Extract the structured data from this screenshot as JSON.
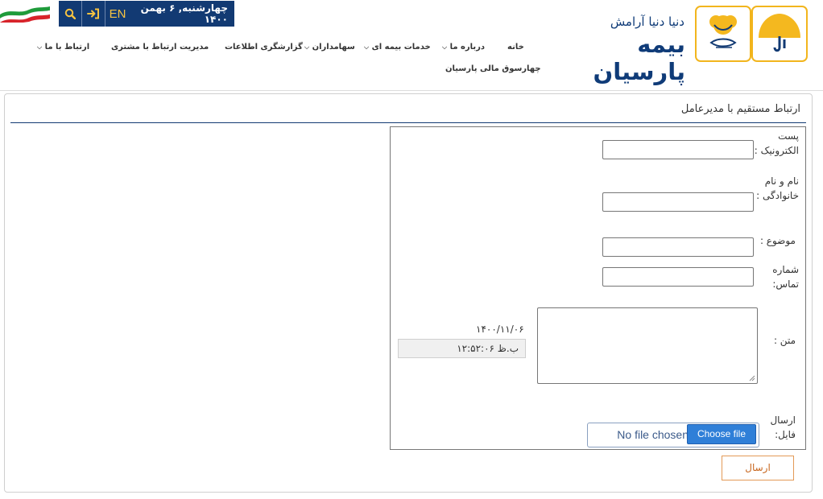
{
  "header": {
    "date_text": "چهارشنبه, ۶ بهمن ۱۴۰۰",
    "lang_label": "EN",
    "search_icon": "search-icon",
    "login_icon": "login-icon",
    "brand_slogan": "دنیا دنیا آرامش",
    "brand_name": "بیمه پارسیان",
    "nav": [
      {
        "label": "خانه",
        "dropdown": false
      },
      {
        "label": "درباره ما",
        "dropdown": true
      },
      {
        "label": "خدمات بیمه ای",
        "dropdown": true
      },
      {
        "label": "سهامداران",
        "dropdown": true
      },
      {
        "label": "گزارشگری اطلاعات",
        "dropdown": false
      },
      {
        "label": "مدیریت ارتباط با مشتری",
        "dropdown": false
      },
      {
        "label": "ارتباط با ما",
        "dropdown": true
      },
      {
        "label": "چهارسوق مالی پارسیان",
        "dropdown": false
      }
    ],
    "colors": {
      "navy": "#123a73",
      "gold": "#f2b51d"
    }
  },
  "page": {
    "title": "ارتباط مستقیم با مدیرعامل"
  },
  "form": {
    "email_label": "پست الکترونیک :",
    "email_value": "",
    "name_label": "نام و نام خانوادگی :",
    "name_value": "",
    "subject_label": "موضوع :",
    "subject_value": "",
    "phone_label": "شماره تماس:",
    "phone_value": "",
    "message_label": "متن :",
    "message_value": "",
    "date_value": "۱۴۰۰/۱۱/۰۶",
    "time_value": "۱۲:۵۲:۰۶ ب.ظ",
    "file_label": "ارسال فایل:",
    "file_button": "Choose file",
    "file_status": "No file chosen",
    "submit_label": "ارسال"
  }
}
